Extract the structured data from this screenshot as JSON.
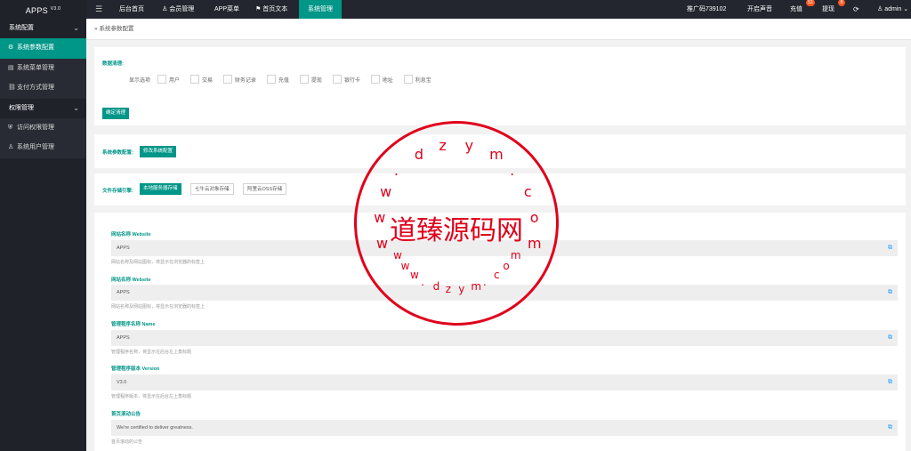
{
  "app": {
    "name": "APPS",
    "version": "V3.0"
  },
  "sidebar": {
    "groups": [
      {
        "label": "系统配置",
        "items": [
          {
            "label": "系统参数配置",
            "icon": "gear-icon",
            "active": true
          },
          {
            "label": "系统菜单管理",
            "icon": "list-icon",
            "active": false
          },
          {
            "label": "支付方式管理",
            "icon": "link-icon",
            "active": false
          }
        ]
      },
      {
        "label": "权限管理",
        "items": [
          {
            "label": "访问权限管理",
            "icon": "shield-icon",
            "active": false
          },
          {
            "label": "系统用户管理",
            "icon": "user-icon",
            "active": false
          }
        ]
      }
    ]
  },
  "topbar": {
    "nav": [
      "后台首页",
      "会员管理",
      "APP菜单",
      "首页文本",
      "系统管理"
    ],
    "active_nav": "系统管理",
    "promo": "推广码739102",
    "sound": "开启声音",
    "recharge": "充值",
    "recharge_badge": "53",
    "withdraw": "提现",
    "withdraw_badge": "8",
    "user": "admin"
  },
  "breadcrumb": "系统参数配置",
  "cleanup": {
    "title": "数据清理:",
    "display_label": "显示选项",
    "options": [
      "用户",
      "交易",
      "财务记录",
      "充值",
      "提现",
      "银行卡",
      "地址",
      "利息宝"
    ],
    "confirm_button": "确定清理"
  },
  "param_config": {
    "label": "系统参数配置:",
    "button": "修改系统配置"
  },
  "storage": {
    "label": "文件存储引擎:",
    "options": [
      "本地服务器存储",
      "七牛云对象存储",
      "阿里云OSS存储"
    ],
    "active": "本地服务器存储"
  },
  "fields": [
    {
      "label": "网站名称 Website",
      "value": "APPS",
      "hint": "网站名称及网站图标，将显示在浏览器的标签上"
    },
    {
      "label": "网站名称 Website",
      "value": "APPS",
      "hint": "网站名称及网站图标，将显示在浏览器的标签上"
    },
    {
      "label": "管理程序名称 Name",
      "value": "APPS",
      "hint": "管理程序名称，将显示在后台左上角标题"
    },
    {
      "label": "管理程序版本 Version",
      "value": "V3.0",
      "hint": "管理程序版本，将显示在后台左上角标题"
    },
    {
      "label": "首页滚动公告",
      "value": "We're certified to deliver greatness.",
      "hint": "首页滚动的公告"
    }
  ],
  "watermark": {
    "center": "道臻源码网",
    "ring_top": "www.dzym.com",
    "ring_bottom": "www.dzym.com"
  },
  "colors": {
    "accent": "#009688",
    "sidebar_bg": "#20222a",
    "topbar_bg": "#23262e",
    "stamp": "#e0001b",
    "badge": "#ff5722"
  }
}
